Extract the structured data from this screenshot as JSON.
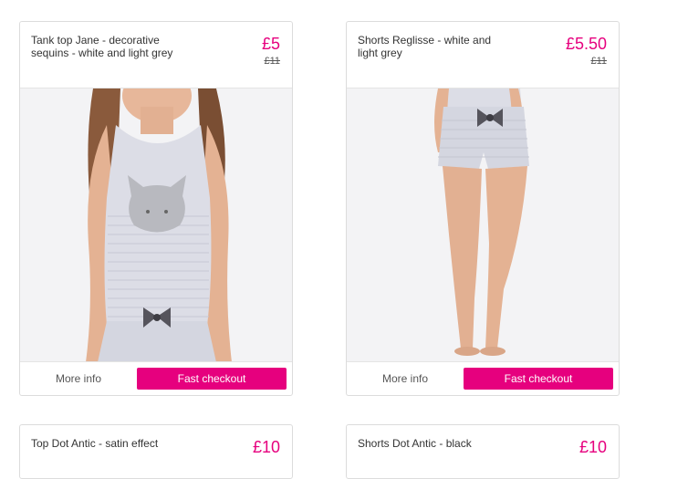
{
  "colors": {
    "accent": "#e6007e",
    "border": "#dcdcdc"
  },
  "products": [
    {
      "title": "Tank top Jane - decorative sequins - white and light grey",
      "price": "£5",
      "old_price": "£11",
      "more_info_label": "More info",
      "checkout_label": "Fast checkout"
    },
    {
      "title": "Shorts Reglisse - white and light grey",
      "price": "£5.50",
      "old_price": "£11",
      "more_info_label": "More info",
      "checkout_label": "Fast checkout"
    },
    {
      "title": "Top Dot Antic - satin effect",
      "price": "£10"
    },
    {
      "title": "Shorts Dot Antic - black",
      "price": "£10"
    }
  ]
}
